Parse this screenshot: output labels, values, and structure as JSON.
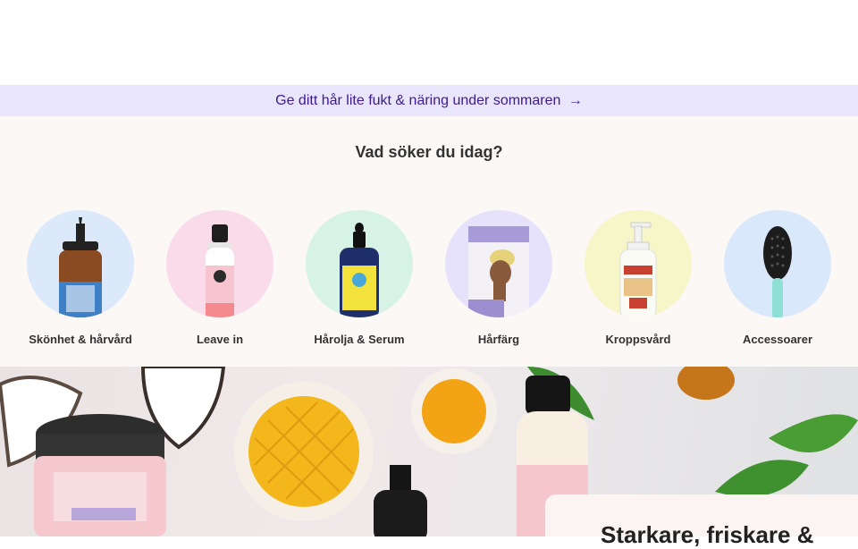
{
  "promo": {
    "text": "Ge ditt hår lite fukt & näring under sommaren",
    "arrow": "→"
  },
  "categories": {
    "heading": "Vad söker du idag?",
    "items": [
      {
        "label": "Skönhet & hårvård",
        "bg": "#dbe9fb"
      },
      {
        "label": "Leave in",
        "bg": "#fadbea"
      },
      {
        "label": "Hårolja & Serum",
        "bg": "#d6f3e6"
      },
      {
        "label": "Hårfärg",
        "bg": "#e6e2fb"
      },
      {
        "label": "Kroppsvård",
        "bg": "#f6f6c8"
      },
      {
        "label": "Accessoarer",
        "bg": "#d9e8fb"
      }
    ]
  },
  "hero": {
    "title": "Starkare, friskare &"
  },
  "colors": {
    "promo_bg": "#e9e6fb",
    "promo_text": "#3e1a8f"
  }
}
